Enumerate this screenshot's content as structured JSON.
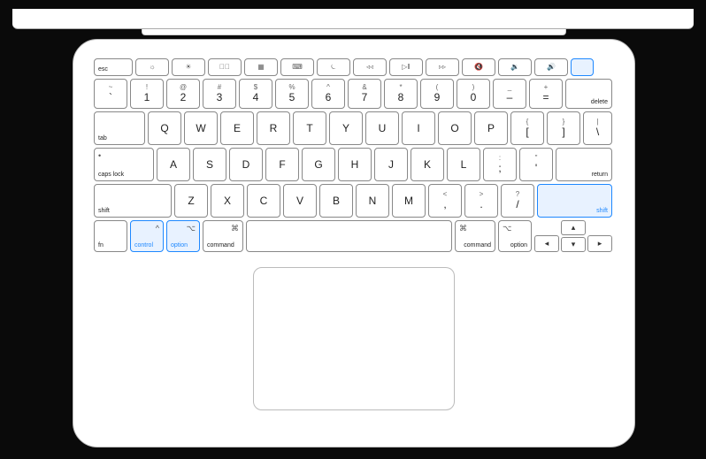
{
  "highlighted_keys": [
    "power",
    "control",
    "option-left",
    "shift-right"
  ],
  "rows": {
    "function": {
      "esc": "esc",
      "f1": "☼",
      "f2": "☀",
      "f3": "⌃⃞",
      "f4": "▦",
      "f5": "⌨",
      "f6": "⏾",
      "f7": "◃◃",
      "f8": "▷‖",
      "f9": "▹▹",
      "f10": "🔇",
      "f11": "🔉",
      "f12": "🔊",
      "power": ""
    },
    "number": {
      "k1": {
        "t": "!",
        "m": "1"
      },
      "k2": {
        "t": "@",
        "m": "2"
      },
      "k3": {
        "t": "#",
        "m": "3"
      },
      "k4": {
        "t": "$",
        "m": "4"
      },
      "k5": {
        "t": "%",
        "m": "5"
      },
      "k6": {
        "t": "^",
        "m": "6"
      },
      "k7": {
        "t": "&",
        "m": "7"
      },
      "k8": {
        "t": "*",
        "m": "8"
      },
      "k9": {
        "t": "(",
        "m": "9"
      },
      "k0": {
        "t": ")",
        "m": "0"
      },
      "minus": {
        "t": "_",
        "m": "–"
      },
      "equal": {
        "t": "+",
        "m": "="
      },
      "backtick": {
        "t": "~",
        "m": "`"
      },
      "delete": "delete"
    },
    "qwerty": {
      "tab": "tab",
      "Q": "Q",
      "W": "W",
      "E": "E",
      "R": "R",
      "T": "T",
      "Y": "Y",
      "U": "U",
      "I": "I",
      "O": "O",
      "P": "P",
      "lbr": {
        "t": "{",
        "m": "["
      },
      "rbr": {
        "t": "}",
        "m": "]"
      },
      "bslash": {
        "t": "|",
        "m": "\\"
      }
    },
    "home": {
      "caps_icon": "•",
      "caps": "caps lock",
      "A": "A",
      "S": "S",
      "D": "D",
      "F": "F",
      "G": "G",
      "H": "H",
      "J": "J",
      "K": "K",
      "L": "L",
      "semi": {
        "t": ":",
        "m": ";"
      },
      "quote": {
        "t": "\"",
        "m": "'"
      },
      "return": "return"
    },
    "shift": {
      "lshift": "shift",
      "Z": "Z",
      "X": "X",
      "C": "C",
      "V": "V",
      "B": "B",
      "N": "N",
      "M": "M",
      "comma": {
        "t": "<",
        "m": ","
      },
      "period": {
        "t": ">",
        "m": "."
      },
      "slash": {
        "t": "?",
        "m": "/"
      },
      "rshift": "shift"
    },
    "bottom": {
      "fn": "fn",
      "control": "control",
      "ctrl_sym": "^",
      "loption": "option",
      "opt_sym": "⌥",
      "lcommand": "command",
      "cmd_sym": "⌘",
      "space": "",
      "rcommand": "command",
      "roption": "option",
      "left": "◂",
      "up": "▴",
      "down": "▾",
      "right": "▸"
    }
  }
}
